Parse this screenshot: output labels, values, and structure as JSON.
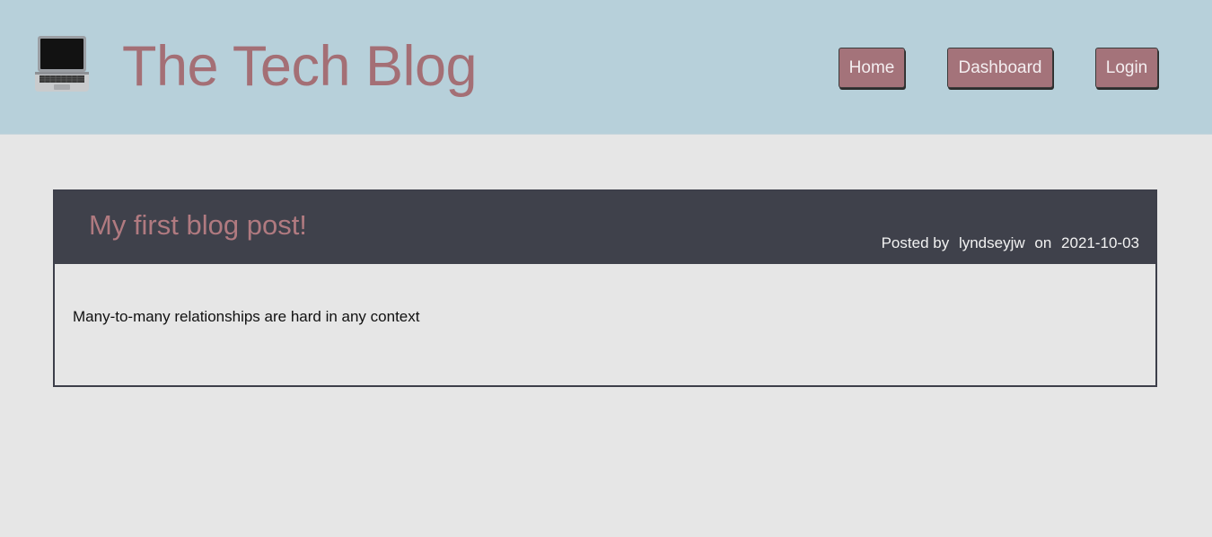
{
  "header": {
    "logo_icon": "laptop-icon",
    "title": "The Tech Blog",
    "nav": {
      "home": "Home",
      "dashboard": "Dashboard",
      "login": "Login"
    },
    "background_color": "#b7d0da",
    "accent_color": "#a4737a"
  },
  "post": {
    "title": "My first blog post!",
    "posted_by_label": "Posted by",
    "author": "lyndseyjw",
    "on_label": "on",
    "date": "2021-10-03",
    "body": "Many-to-many relationships are hard in any context",
    "header_color": "#3f414b"
  }
}
